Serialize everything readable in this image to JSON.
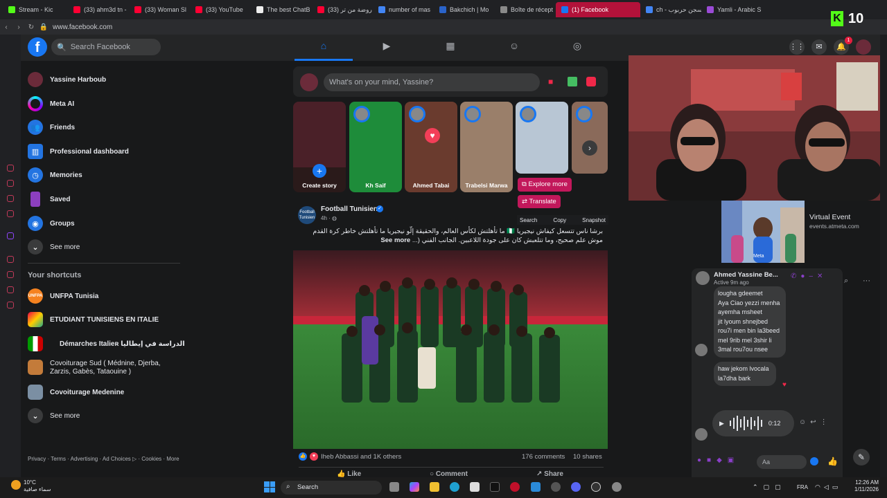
{
  "browser": {
    "tabs": [
      {
        "label": "Stream - Kic",
        "color": "#53fc18"
      },
      {
        "label": "(33) ahm3d tn -",
        "color": "#ff0033"
      },
      {
        "label": "(33) Woman Sl",
        "color": "#ff0033"
      },
      {
        "label": "(33) YouTube",
        "color": "#ff0033"
      },
      {
        "label": "The best ChatB",
        "color": "#eeeeee"
      },
      {
        "label": "(33) روضة من تر",
        "color": "#ff0033"
      },
      {
        "label": "number of mas",
        "color": "#4285f4"
      },
      {
        "label": "Bakchich | Mo",
        "color": "#2a63c9"
      },
      {
        "label": "Boîte de récept",
        "color": "#8a8a8a"
      },
      {
        "label": "(1) Facebook",
        "color": "#1877f2",
        "active": true
      },
      {
        "label": "ch - سجن حربوب",
        "color": "#4285f4"
      },
      {
        "label": "Yamli - Arabic S",
        "color": "#9b4bd6"
      }
    ],
    "url": "www.facebook.com",
    "overlay_score": "10"
  },
  "header": {
    "logo": "f",
    "search_placeholder": "Search Facebook",
    "notification_badge": "1"
  },
  "sidebar": {
    "items": [
      {
        "label": "Yassine Harboub"
      },
      {
        "label": "Meta AI"
      },
      {
        "label": "Friends"
      },
      {
        "label": "Professional dashboard"
      },
      {
        "label": "Memories"
      },
      {
        "label": "Saved"
      },
      {
        "label": "Groups"
      },
      {
        "label": "See more"
      }
    ],
    "shortcuts_title": "Your shortcuts",
    "shortcuts": [
      {
        "label": "UNFPA Tunisia"
      },
      {
        "label": "ETUDIANT TUNISIENS EN ITALIE"
      },
      {
        "label": "Démarches Italieʀ الدراسة في إيطاليا"
      },
      {
        "label": "Covoiturage Sud ( Médnine, Djerba, Zarzis, Gabès, Tataouine )"
      },
      {
        "label": "Covoiturage Medenine"
      },
      {
        "label": "See more"
      }
    ],
    "footer": "Privacy · Terms · Advertising · Ad Choices ▷ · Cookies · More"
  },
  "composer": {
    "placeholder": "What's on your mind, Yassine?"
  },
  "stories": [
    {
      "name": "Create story",
      "bg": "#2a1a1a"
    },
    {
      "name": "Kh Saif",
      "bg": "#1e8c3a"
    },
    {
      "name": "Ahmed Tabai",
      "bg": "#6a3b2e"
    },
    {
      "name": "Trabelsi Marwa",
      "bg": "#9a7f6a"
    },
    {
      "name": "",
      "bg": "#b8c6d4"
    },
    {
      "name": "",
      "bg": "#8a6a5a"
    }
  ],
  "overlay_buttons": {
    "explore": "Explore more",
    "translate": "Translate",
    "selection": [
      "Search",
      "Copy",
      "Snapshot"
    ]
  },
  "post": {
    "author": "Football Tunisien",
    "avatar_text": "Football Tunisien",
    "time": "4h · ",
    "text_line1": "برشا ناس تتسعل كيفاش نيجيريا 🇳🇬 ما تأهلتش لكأس العالم، والحقيقة إلّو نيجيريا ما تأهلتش خاطر كرة القدم",
    "text_line2": "موش علم صحيح، وما تتلعبش كان على جودة اللاعبين. الجانب الفني (...",
    "see_more": "See more",
    "reactions_text": "Iheb Abbassi and 1K others",
    "comments": "176 comments",
    "shares": "10 shares",
    "actions": [
      "Like",
      "Comment",
      "Share"
    ]
  },
  "sponsored": {
    "title": "Virtual Event",
    "url": "events.atmeta.com",
    "img_brand": "Meta"
  },
  "chat": {
    "name": "Ahmed Yassine Be...",
    "status": "Active 9m ago",
    "bubble1": [
      "lougha gdeemet",
      "Aya Ciao yezzi menha",
      "ayemha msheet",
      "jit lyoum shnejbed",
      "rou7i men bin la3beed",
      "mel 9rib mel 3shir li",
      "3mal rou7ou nsee"
    ],
    "bubble2": [
      "haw jekom lvocala",
      "la7dha bark"
    ],
    "voice_duration": "0:12",
    "input_placeholder": "Aa"
  },
  "taskbar": {
    "weather_temp": "10°C",
    "weather_desc": "سماء صافية",
    "search": "Search",
    "lang": "FRA",
    "time": "12:26 AM",
    "date": "1/11/2026"
  },
  "colors": {
    "fb_blue": "#1877f2",
    "accent_pink": "#c2185b",
    "bg": "#18191a",
    "card": "#242526"
  }
}
